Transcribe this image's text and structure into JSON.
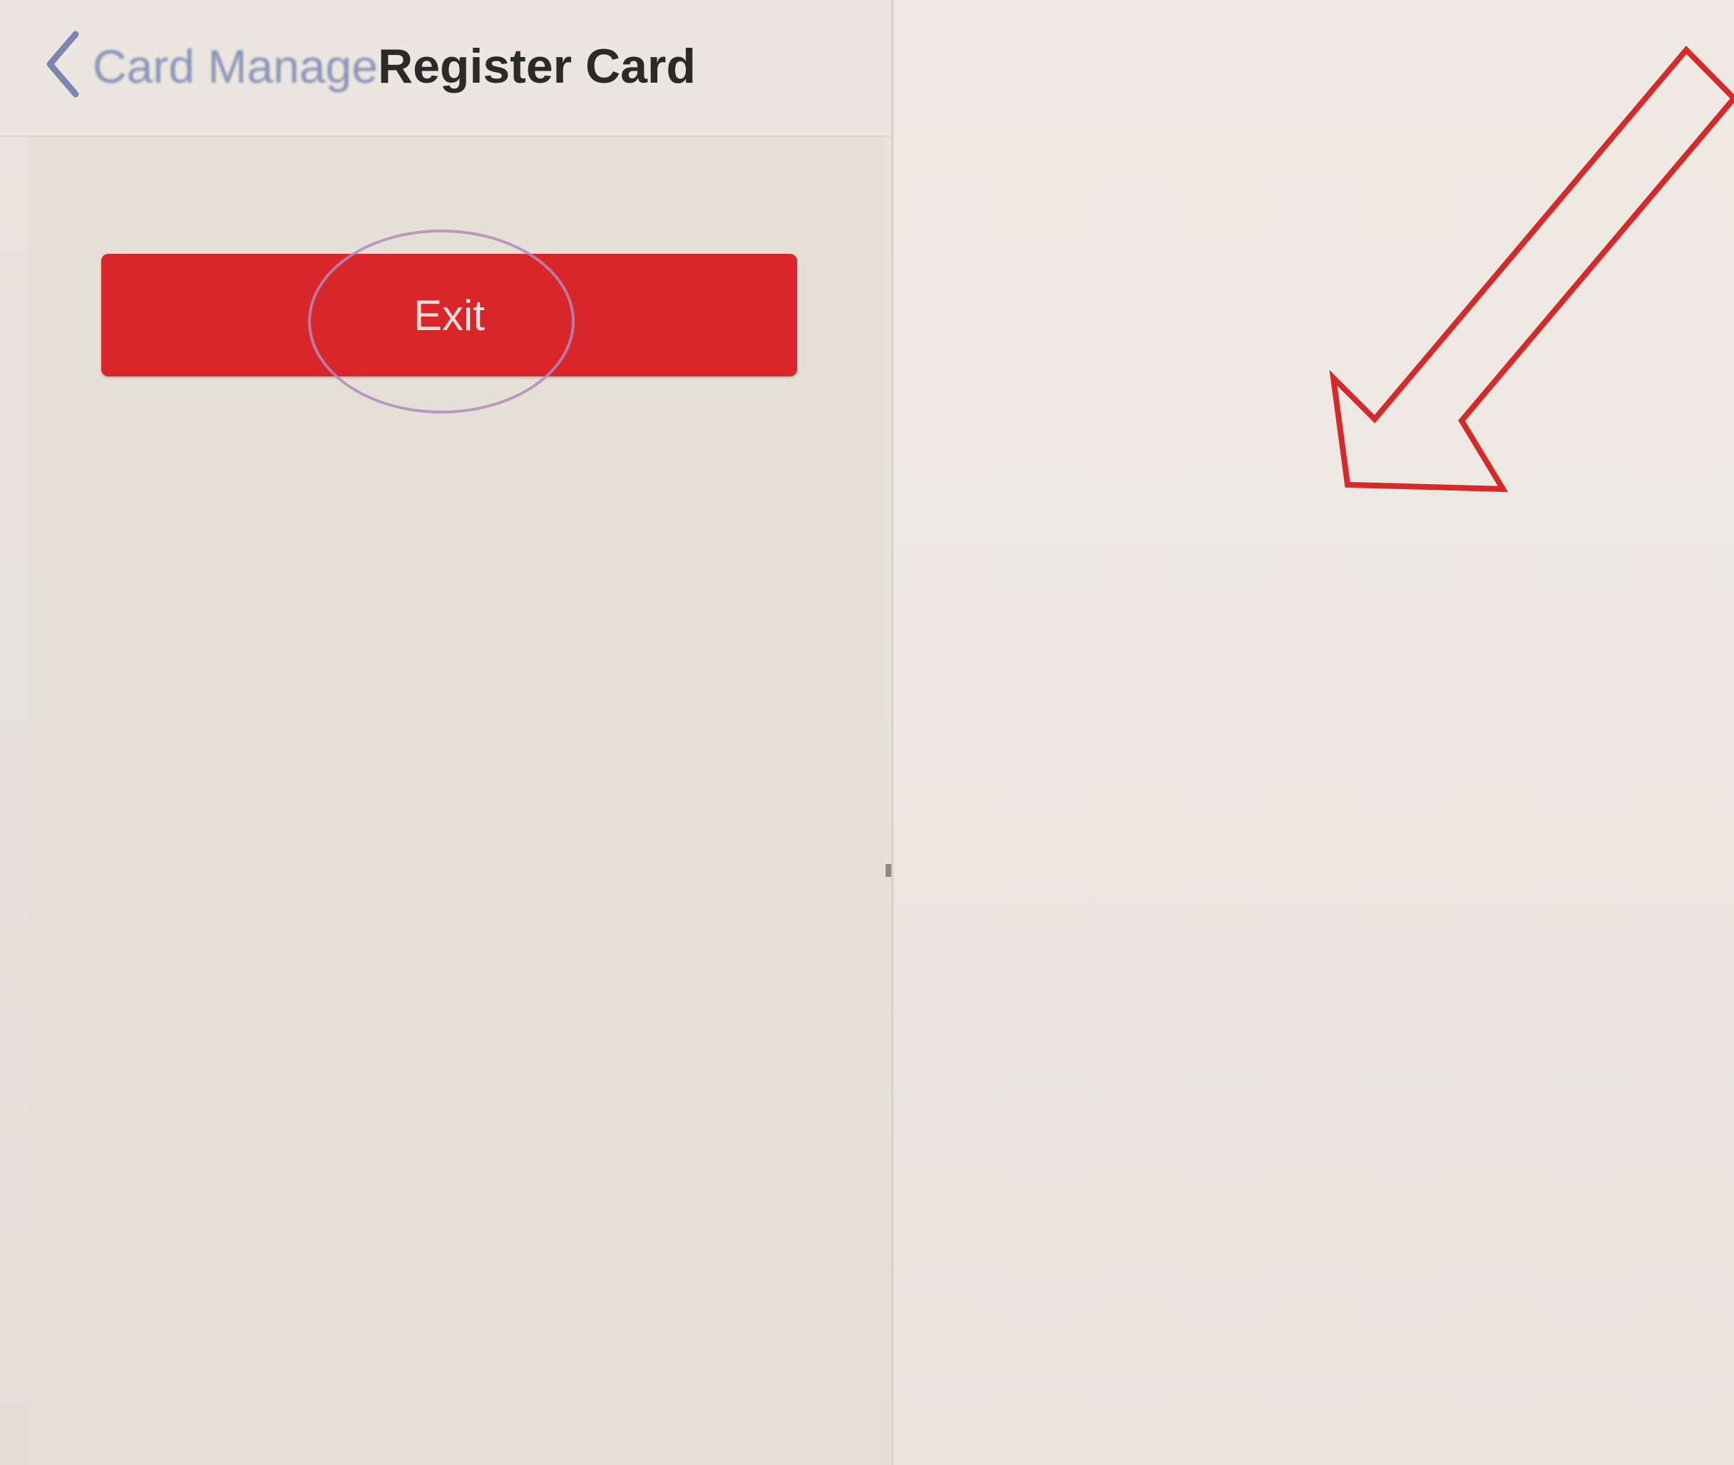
{
  "nav": {
    "back_label": "Card Manage",
    "title": "Register Card"
  },
  "main": {
    "exit_label": "Exit"
  },
  "colors": {
    "exit_button": "#d8262b",
    "back_label": "#8a93b8",
    "annotation_arrow": "#d62a2a",
    "annotation_ellipse": "#b58ab8"
  },
  "icons": {
    "back": "chevron-left-icon",
    "annotation": "arrow-down-left-icon"
  }
}
